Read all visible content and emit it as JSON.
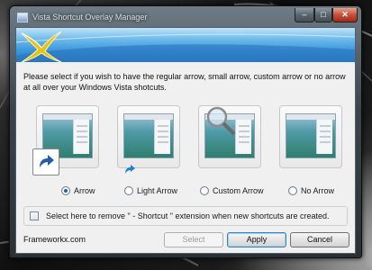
{
  "window": {
    "title": "Vista Shortcut Overlay Manager",
    "controls": {
      "minimize": "–",
      "maximize": "□",
      "close": "✕"
    }
  },
  "instructions": "Please select if you wish to have the regular arrow, small arrow, custom arrow or no arrow at all over your Windows Vista shotcuts.",
  "options": [
    {
      "label": "Arrow",
      "selected": true,
      "preview_icon": "large-arrow-icon"
    },
    {
      "label": "Light Arrow",
      "selected": false,
      "preview_icon": "small-arrow-icon"
    },
    {
      "label": "Custom Arrow",
      "selected": false,
      "preview_icon": "magnifier-icon"
    },
    {
      "label": "No Arrow",
      "selected": false,
      "preview_icon": "none"
    }
  ],
  "checkbox": {
    "label": "Select here to remove \" - Shortcut \" extension when new shortcuts are created.",
    "checked": false
  },
  "footer": {
    "brand": "Frameworkx.com",
    "select_label": "Select",
    "apply_label": "Apply",
    "cancel_label": "Cancel"
  },
  "colors": {
    "banner": "#3d98dc",
    "logo": "#e8c21a",
    "accent": "#1f5fa8"
  }
}
